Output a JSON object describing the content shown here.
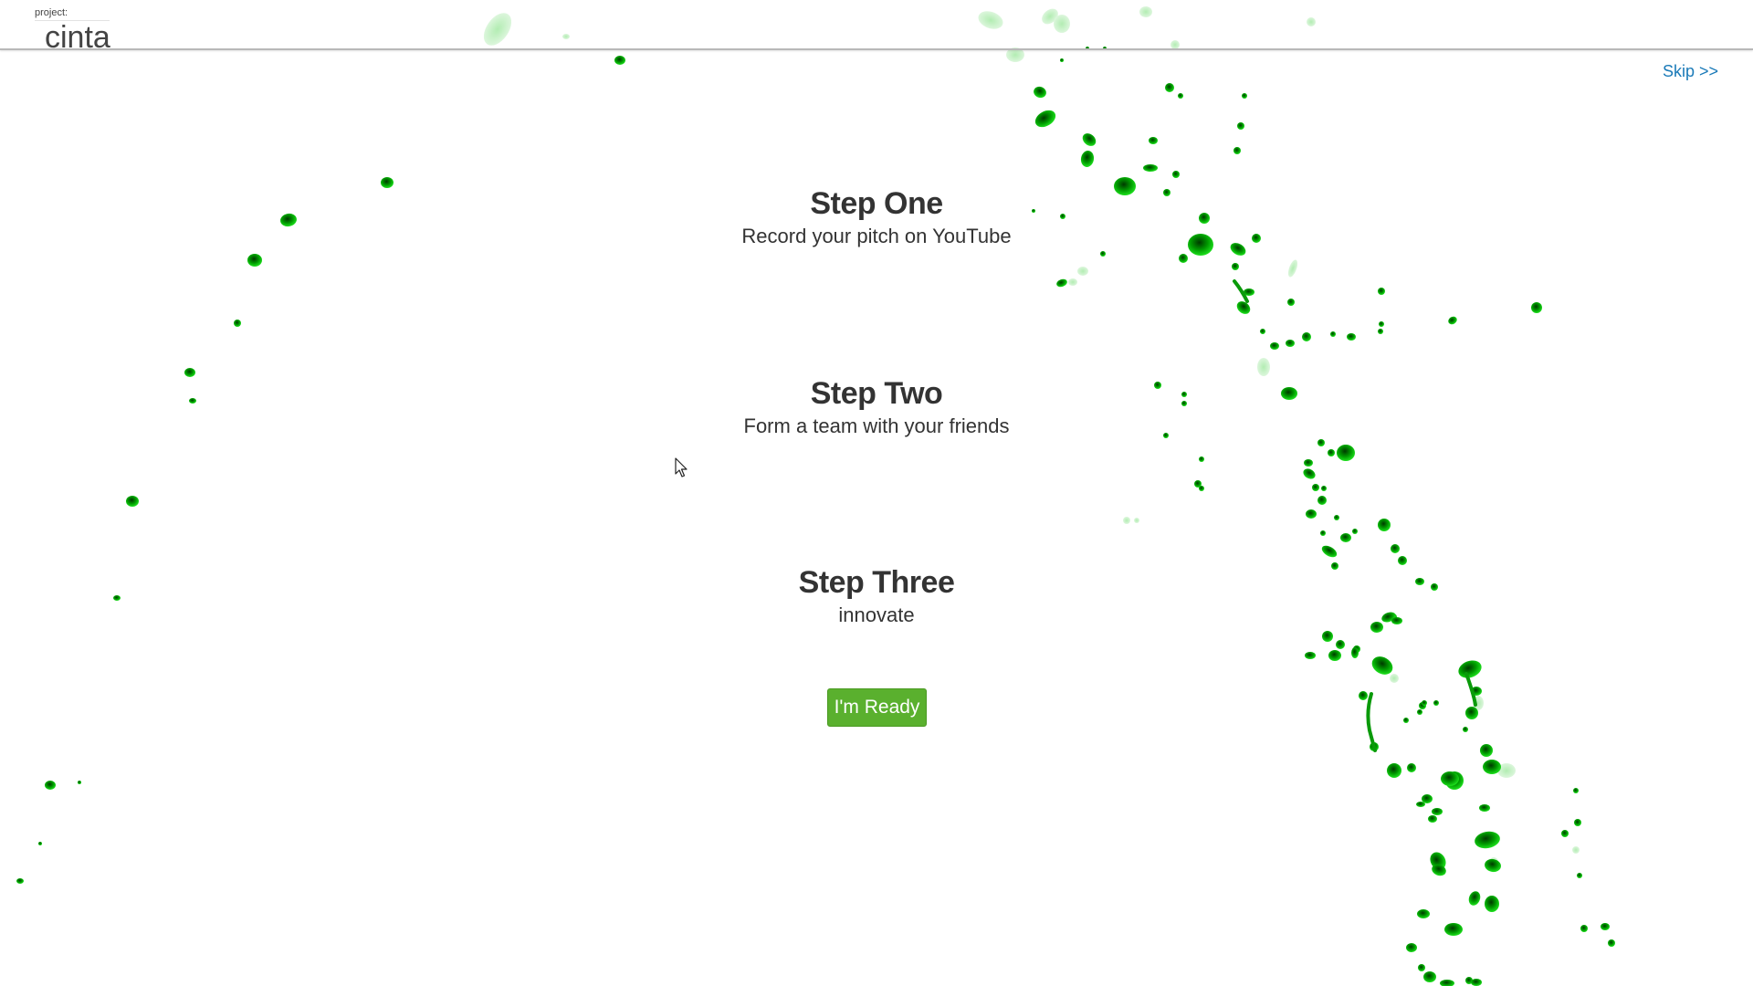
{
  "header": {
    "project_label": "project:",
    "project_name": "cinta"
  },
  "skip_link": "Skip >>",
  "steps": [
    {
      "title": "Step One",
      "description": "Record your pitch on YouTube"
    },
    {
      "title": "Step Two",
      "description": "Form a team with your friends"
    },
    {
      "title": "Step Three",
      "description": "innovate"
    }
  ],
  "ready_button": "I'm Ready",
  "colors": {
    "link": "#1a7ab8",
    "button": "#5ab02e",
    "splatter_bright": "#00d400",
    "splatter_dark": "#005a00",
    "text": "#333333"
  },
  "icons": {
    "cursor": "mouse-pointer-icon",
    "background": "green-paint-splatter"
  }
}
